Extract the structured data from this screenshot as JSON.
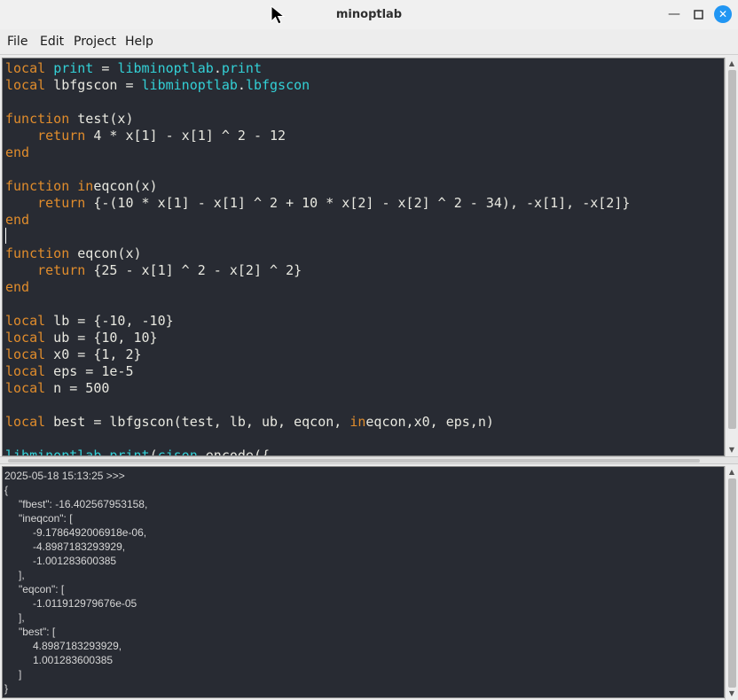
{
  "window": {
    "title": "minoptlab"
  },
  "menu": [
    "File",
    "Edit",
    "Project",
    "Help"
  ],
  "editor": {
    "lines": [
      [
        [
          "kw",
          "local"
        ],
        [
          "t",
          " "
        ],
        [
          "fn",
          "print"
        ],
        [
          "t",
          " = "
        ],
        [
          "fn",
          "libminoptlab"
        ],
        [
          "t",
          "."
        ],
        [
          "fn",
          "print"
        ]
      ],
      [
        [
          "kw",
          "local"
        ],
        [
          "t",
          " lbfgscon = "
        ],
        [
          "fn",
          "libminoptlab"
        ],
        [
          "t",
          "."
        ],
        [
          "fn",
          "lbfgscon"
        ]
      ],
      [],
      [
        [
          "kw",
          "function"
        ],
        [
          "t",
          " test(x)"
        ]
      ],
      [
        [
          "t",
          "    "
        ],
        [
          "kw",
          "return"
        ],
        [
          "t",
          " 4 * x[1] - x[1] ^ 2 - 12"
        ]
      ],
      [
        [
          "kw",
          "end"
        ]
      ],
      [],
      [
        [
          "kw",
          "function"
        ],
        [
          "t",
          " "
        ],
        [
          "kw",
          "in"
        ],
        [
          "t",
          "eqcon(x)"
        ]
      ],
      [
        [
          "t",
          "    "
        ],
        [
          "kw",
          "return"
        ],
        [
          "t",
          " {-(10 * x[1] - x[1] ^ 2 + 10 * x[2] - x[2] ^ 2 - 34), -x[1], -x[2]}"
        ]
      ],
      [
        [
          "kw",
          "end"
        ]
      ],
      [],
      [
        [
          "kw",
          "function"
        ],
        [
          "t",
          " eqcon(x)"
        ]
      ],
      [
        [
          "t",
          "    "
        ],
        [
          "kw",
          "return"
        ],
        [
          "t",
          " {25 - x[1] ^ 2 - x[2] ^ 2}"
        ]
      ],
      [
        [
          "kw",
          "end"
        ]
      ],
      [],
      [
        [
          "kw",
          "local"
        ],
        [
          "t",
          " lb = {-10, -10}"
        ]
      ],
      [
        [
          "kw",
          "local"
        ],
        [
          "t",
          " ub = {10, 10}"
        ]
      ],
      [
        [
          "kw",
          "local"
        ],
        [
          "t",
          " x0 = {1, 2}"
        ]
      ],
      [
        [
          "kw",
          "local"
        ],
        [
          "t",
          " eps = 1e-5"
        ]
      ],
      [
        [
          "kw",
          "local"
        ],
        [
          "t",
          " n = 500"
        ]
      ],
      [],
      [
        [
          "kw",
          "local"
        ],
        [
          "t",
          " best = lbfgscon(test, lb, ub, eqcon, "
        ],
        [
          "kw",
          "in"
        ],
        [
          "t",
          "eqcon,x0, eps,n)"
        ]
      ],
      [],
      [
        [
          "fn",
          "libminoptlab"
        ],
        [
          "t",
          "."
        ],
        [
          "fn",
          "print"
        ],
        [
          "t",
          "("
        ],
        [
          "fn",
          "cjson"
        ],
        [
          "t",
          ".encode({"
        ]
      ]
    ]
  },
  "output": {
    "lines": [
      {
        "indent": 0,
        "text": "2025-05-18 15:13:25 >>>"
      },
      {
        "indent": 0,
        "text": "{"
      },
      {
        "indent": 1,
        "text": "\"fbest\": -16.402567953158,"
      },
      {
        "indent": 1,
        "text": "\"ineqcon\": ["
      },
      {
        "indent": 2,
        "text": "-9.1786492006918e-06,"
      },
      {
        "indent": 2,
        "text": "-4.8987183293929,"
      },
      {
        "indent": 2,
        "text": "-1.001283600385"
      },
      {
        "indent": 1,
        "text": "],"
      },
      {
        "indent": 1,
        "text": "\"eqcon\": ["
      },
      {
        "indent": 2,
        "text": "-1.011912979676e-05"
      },
      {
        "indent": 1,
        "text": "],"
      },
      {
        "indent": 1,
        "text": "\"best\": ["
      },
      {
        "indent": 2,
        "text": "4.8987183293929,"
      },
      {
        "indent": 2,
        "text": "1.001283600385"
      },
      {
        "indent": 1,
        "text": "]"
      },
      {
        "indent": 0,
        "text": "}"
      }
    ]
  },
  "colors": {
    "keyword": "#e08c2c",
    "identifier": "#33d0d6",
    "editor_bg": "#282b33",
    "close_button": "#2196f3"
  },
  "icons": {
    "minimize": "minimize-icon",
    "maximize": "maximize-icon",
    "close": "close-icon",
    "cursor": "mouse-cursor-icon"
  }
}
